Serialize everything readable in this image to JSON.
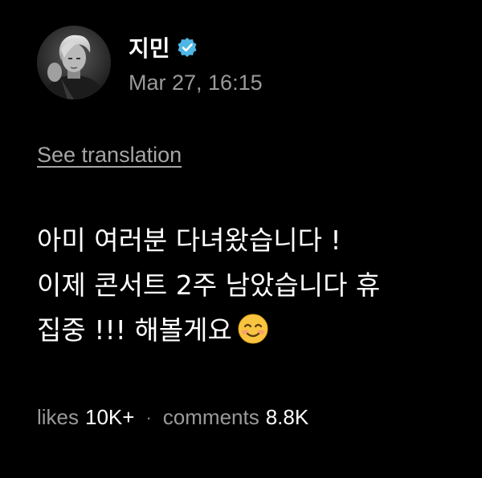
{
  "post": {
    "author": {
      "name": "지민",
      "verified": true,
      "verified_color": "#4fb6e6",
      "avatar_icon": "profile-photo"
    },
    "timestamp": "Mar 27, 16:15",
    "translate_label": "See translation",
    "content_lines": [
      "아미 여러분 다녀왔습니다 !",
      "이제 콘서트 2주 남았습니다 휴",
      "집중 !!! 해볼게요"
    ],
    "content_emoji": "smiling-face-with-smiling-eyes",
    "stats": {
      "likes_label": "likes",
      "likes_value": "10K+",
      "separator": "·",
      "comments_label": "comments",
      "comments_value": "8.8K"
    }
  },
  "colors": {
    "background": "#000000",
    "text_primary": "#ffffff",
    "text_secondary": "#9a9a9a",
    "verified_badge": "#4fb6e6"
  }
}
